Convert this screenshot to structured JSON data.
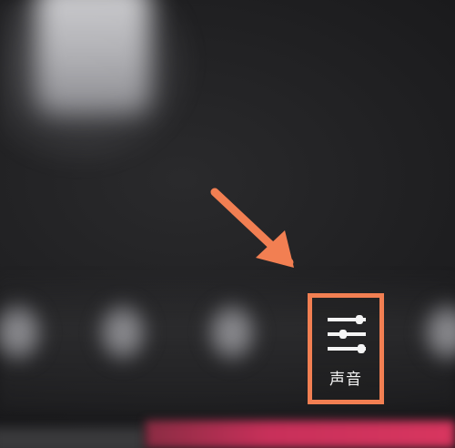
{
  "toolbar": {
    "sound_label": "声音"
  },
  "icons": {
    "sound": "sliders-icon",
    "pointer": "arrow-icon"
  },
  "colors": {
    "highlight": "#f27f52",
    "accent_bar": "#d8365f",
    "background": "#1d1d1f"
  }
}
